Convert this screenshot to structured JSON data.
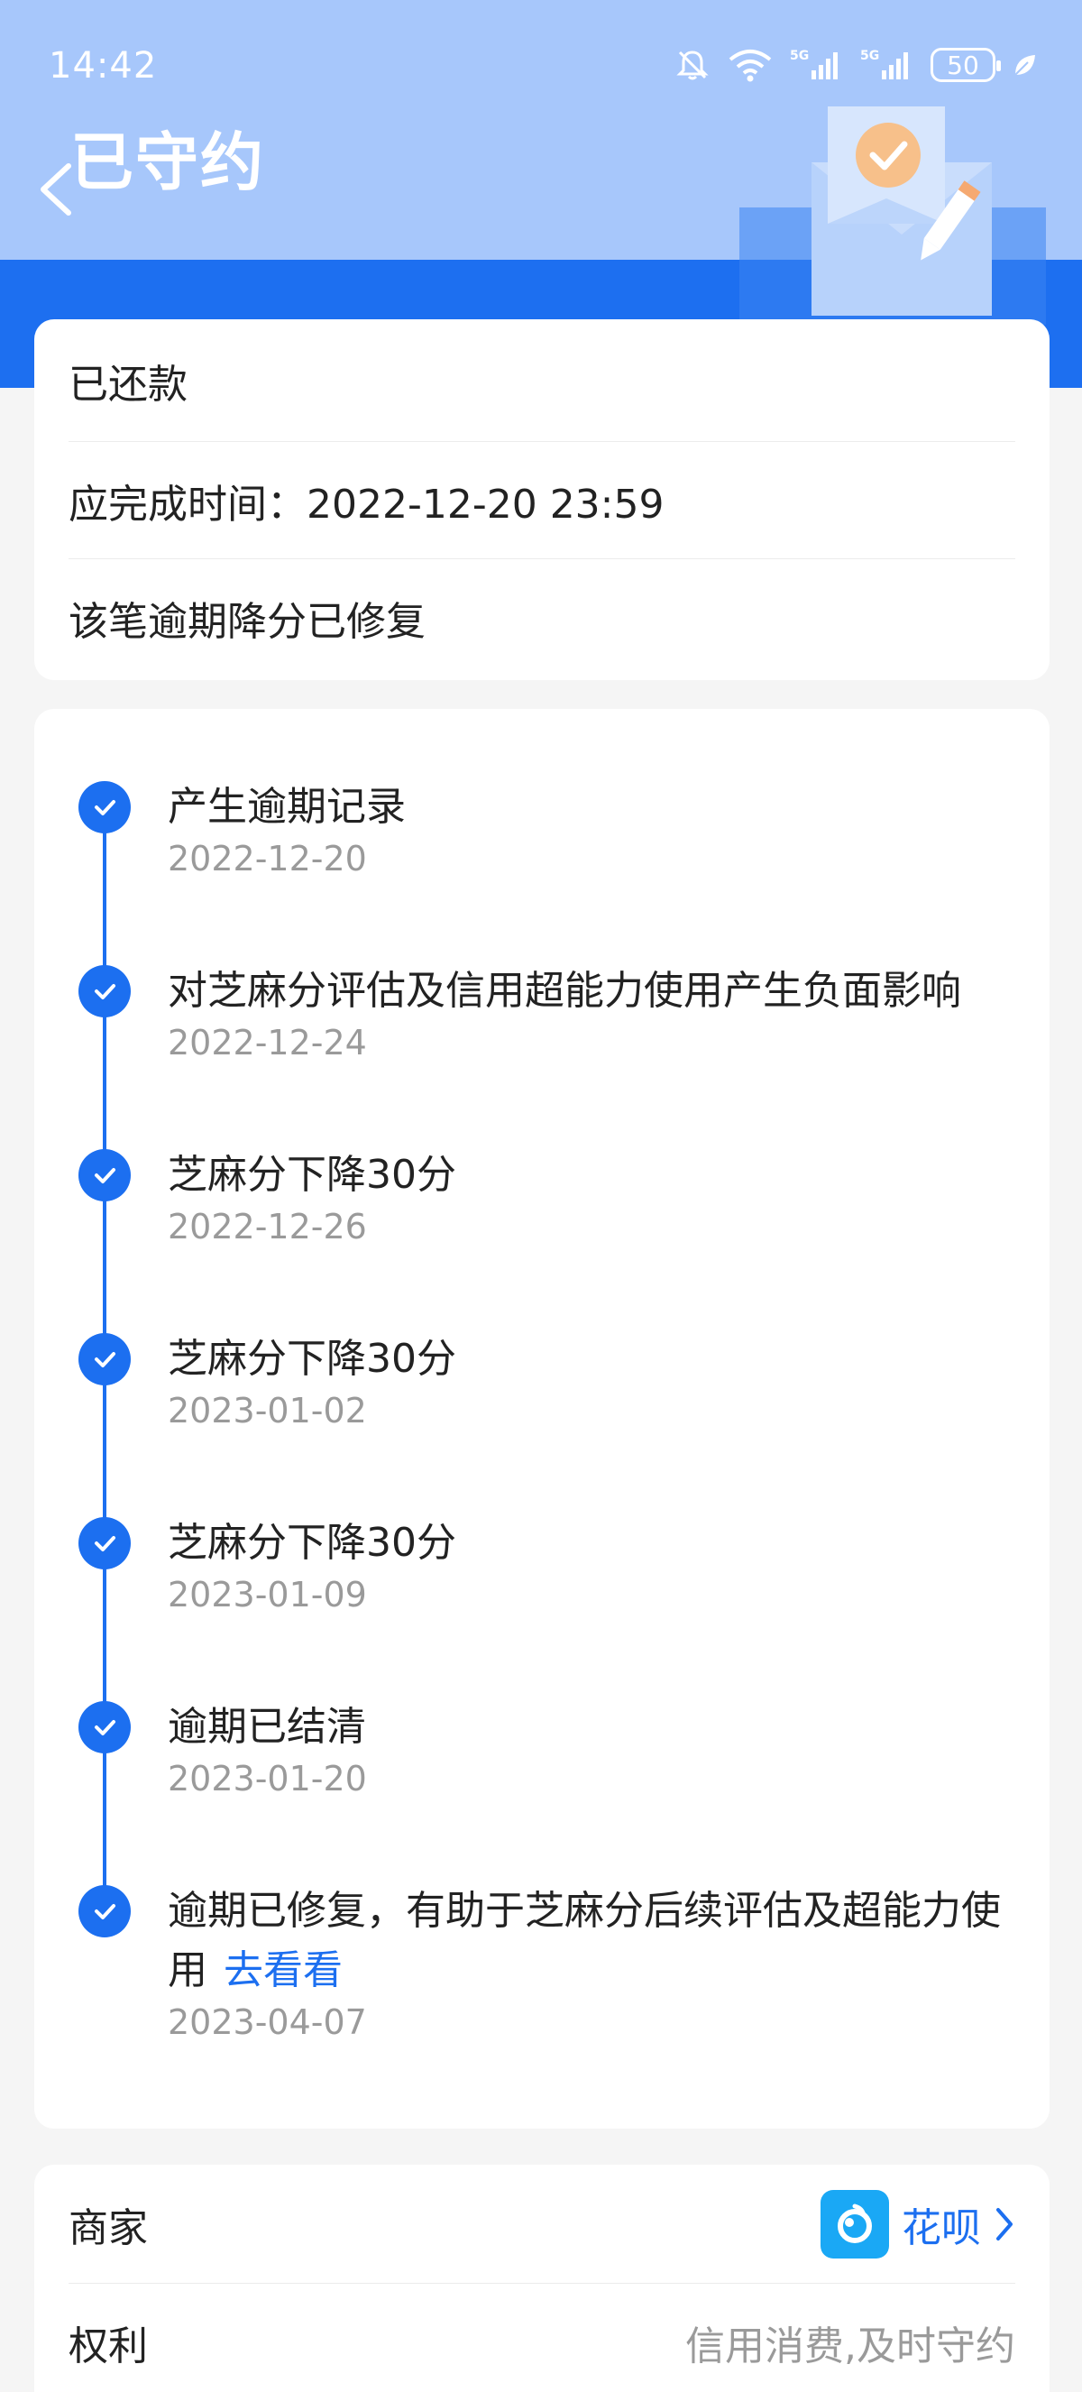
{
  "status_bar": {
    "time": "14:42",
    "battery": "50",
    "icons": [
      "mute-bell-icon",
      "wifi-icon",
      "5g-signal-icon",
      "5g-signal-icon",
      "battery-icon",
      "leaf-icon"
    ]
  },
  "header": {
    "title": "已守约",
    "back_icon": "chevron-left-icon",
    "illustration": "envelope-check-pencil-illustration",
    "accent_color": "#1c6ff0"
  },
  "summary": {
    "status": "已还款",
    "deadline": "应完成时间：2022-12-20 23:59",
    "note": "该笔逾期降分已修复"
  },
  "timeline": {
    "items": [
      {
        "title": "产生逾期记录",
        "date": "2022-12-20"
      },
      {
        "title": "对芝麻分评估及信用超能力使用产生负面影响",
        "date": "2022-12-24"
      },
      {
        "title": "芝麻分下降30分",
        "date": "2022-12-26"
      },
      {
        "title": "芝麻分下降30分",
        "date": "2023-01-02"
      },
      {
        "title": "芝麻分下降30分",
        "date": "2023-01-09"
      },
      {
        "title": "逾期已结清",
        "date": "2023-01-20"
      },
      {
        "title": "逾期已修复，有助于芝麻分后续评估及超能力使用",
        "link": "去看看",
        "date": "2023-04-07"
      }
    ]
  },
  "details": {
    "merchant_label": "商家",
    "merchant_value": "花呗",
    "rights_label": "权利",
    "rights_value": "信用消费,及时守约"
  }
}
